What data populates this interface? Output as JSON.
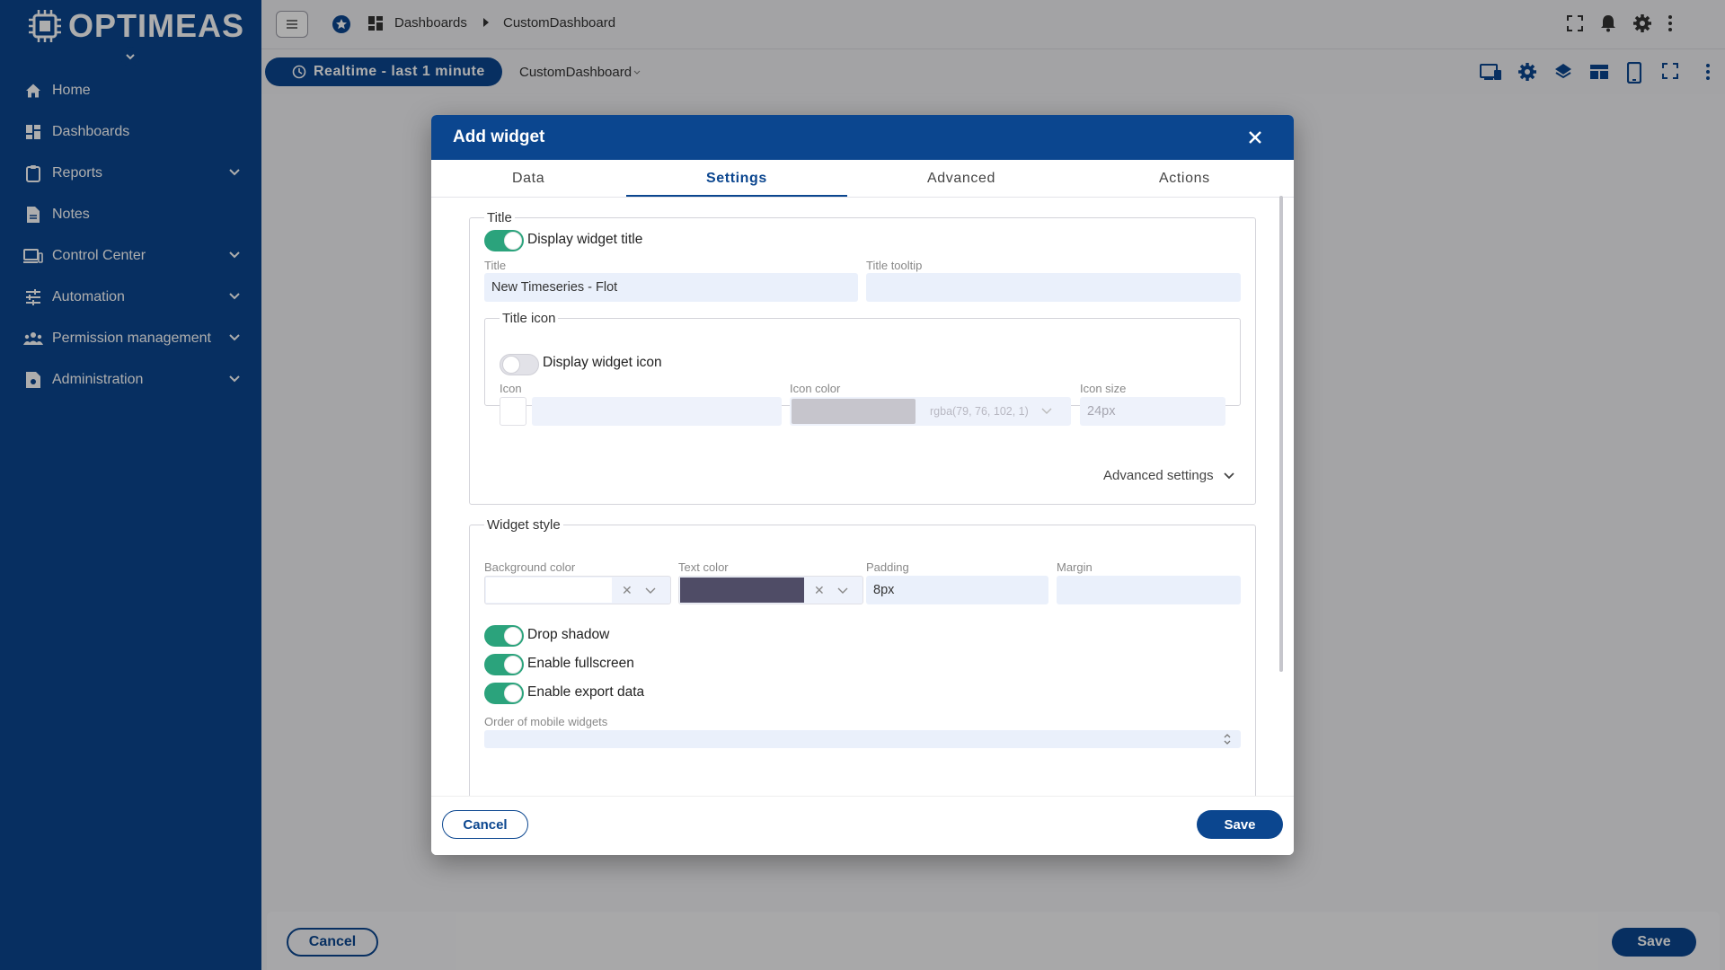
{
  "app": {
    "logo_text": "OPTIMEAS"
  },
  "sidebar": {
    "items": [
      {
        "label": "Home",
        "icon": "home-icon"
      },
      {
        "label": "Dashboards",
        "icon": "dashboard-icon"
      },
      {
        "label": "Reports",
        "icon": "clipboard-icon",
        "expandable": true
      },
      {
        "label": "Notes",
        "icon": "note-icon"
      },
      {
        "label": "Control Center",
        "icon": "devices-icon",
        "expandable": true
      },
      {
        "label": "Automation",
        "icon": "tune-icon",
        "expandable": true
      },
      {
        "label": "Permission management",
        "icon": "people-icon",
        "expandable": true
      },
      {
        "label": "Administration",
        "icon": "admin-icon",
        "expandable": true
      }
    ]
  },
  "topbar": {
    "breadcrumb": [
      "Dashboards",
      "CustomDashboard"
    ]
  },
  "toolbar": {
    "timewindow_label": "Realtime - last 1 minute",
    "dashboard_select": "CustomDashboard"
  },
  "bottom_bar": {
    "cancel_label": "Cancel",
    "save_label": "Save"
  },
  "dialog": {
    "title": "Add widget",
    "tabs": [
      {
        "label": "Data",
        "active": false
      },
      {
        "label": "Settings",
        "active": true
      },
      {
        "label": "Advanced",
        "active": false
      },
      {
        "label": "Actions",
        "active": false
      }
    ],
    "title_section": {
      "legend": "Title",
      "display_title_label": "Display widget title",
      "display_title_on": true,
      "title_label": "Title",
      "title_value": "New Timeseries - Flot",
      "tooltip_label": "Title tooltip",
      "tooltip_value": ""
    },
    "title_icon_section": {
      "legend": "Title icon",
      "display_icon_label": "Display widget icon",
      "display_icon_on": false,
      "icon_label": "Icon",
      "icon_color_label": "Icon color",
      "icon_color_value": "rgba(79, 76, 102, 1)",
      "icon_color_swatch": "#c6c5cc",
      "icon_size_label": "Icon size",
      "icon_size_value": "24px",
      "advanced_settings_label": "Advanced settings"
    },
    "widget_style": {
      "legend": "Widget style",
      "bg_color_label": "Background color",
      "text_color_label": "Text color",
      "text_color_swatch": "#4f4c66",
      "padding_label": "Padding",
      "padding_value": "8px",
      "margin_label": "Margin",
      "margin_value": "",
      "drop_shadow_label": "Drop shadow",
      "drop_shadow_on": true,
      "fullscreen_label": "Enable fullscreen",
      "fullscreen_on": true,
      "export_label": "Enable export data",
      "export_on": true,
      "mobile_order_label": "Order of mobile widgets"
    },
    "footer": {
      "cancel_label": "Cancel",
      "save_label": "Save"
    }
  },
  "colors": {
    "brand": "#0b468f",
    "toggle_on": "#2ba37c"
  }
}
